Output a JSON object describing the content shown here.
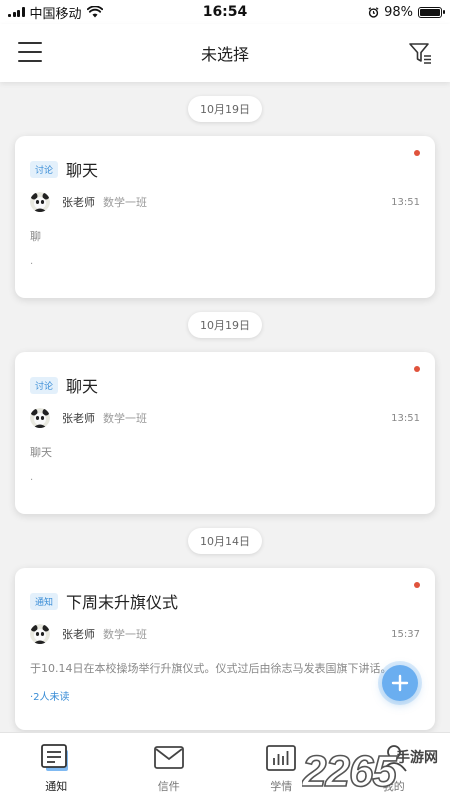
{
  "status_bar": {
    "carrier": "中国移动",
    "time": "16:54",
    "battery": "98%",
    "battery_level": 0.98
  },
  "header": {
    "title": "未选择",
    "menu_icon": "hamburger-menu-icon",
    "filter_icon": "filter-icon"
  },
  "feed": [
    {
      "date": "10月19日",
      "tag": "讨论",
      "title": "聊天",
      "author": "张老师",
      "class": "数学一班",
      "time": "13:51",
      "content": "聊",
      "extra": "."
    },
    {
      "date": "10月19日",
      "tag": "讨论",
      "title": "聊天",
      "author": "张老师",
      "class": "数学一班",
      "time": "13:51",
      "content": "聊天",
      "extra": "."
    },
    {
      "date": "10月14日",
      "tag": "通知",
      "title": "下周末升旗仪式",
      "author": "张老师",
      "class": "数学一班",
      "time": "15:37",
      "content": "于10.14日在本校操场举行升旗仪式。仪式过后由徐志马发表国旗下讲话。",
      "extra": "·2人未读"
    }
  ],
  "tabs": [
    {
      "label": "通知",
      "icon": "notice-icon",
      "active": true
    },
    {
      "label": "信件",
      "icon": "mail-icon",
      "active": false
    },
    {
      "label": "学情",
      "icon": "chart-icon",
      "active": false
    },
    {
      "label": "我的",
      "icon": "profile-icon",
      "active": false
    }
  ],
  "watermark": {
    "number": "2265",
    "text": "手游网"
  },
  "colors": {
    "accent": "#3a8dd6",
    "unread_dot": "#e0533c",
    "fab": "#6aaef0",
    "background": "#f2f2f2"
  }
}
